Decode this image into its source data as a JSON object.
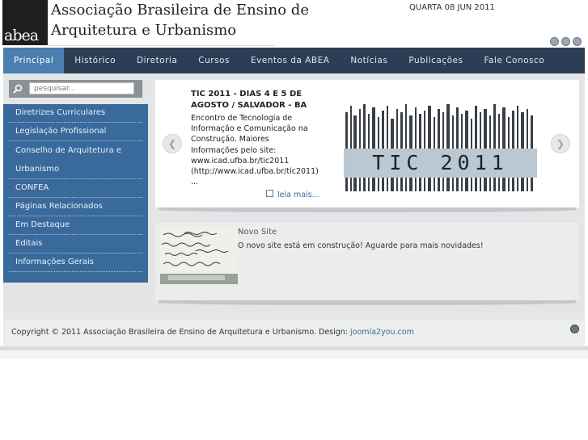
{
  "header": {
    "logo_mark": "abea",
    "logo_line1": "Associação Brasileira de Ensino de",
    "logo_line2": "Arquitetura e Urbanismo",
    "date": "QUARTA 08 JUN 2011",
    "font_tools": [
      "reset-font-icon",
      "decrease-font-icon",
      "increase-font-icon"
    ]
  },
  "nav": {
    "items": [
      "Principal",
      "Histórico",
      "Diretoria",
      "Cursos",
      "Eventos da ABEA",
      "Notícias",
      "Publicações",
      "Fale Conosco"
    ],
    "active_index": 0
  },
  "search": {
    "placeholder": "pesquisar..."
  },
  "sidebar": {
    "items": [
      "Diretrizes Curriculares",
      "Legislação Profissional",
      "Conselho de Arquitetura e Urbanismo",
      "CONFEA",
      "Páginas Relacionados",
      "Em Destaque",
      "Editais",
      "Informações Gerais"
    ]
  },
  "feature": {
    "title": "TIC 2011 - DIAS 4 E 5 DE AGOSTO / SALVADOR - BA",
    "body": "Encontro de Tecnologia de Informação e Comunicação na Construção. Maiores Informações pelo site: www.icad.ufba.br/tic2011 (http://www.icad.ufba.br/tic2011) ...",
    "read_more": "leia mais...",
    "banner_text": "TIC 2011"
  },
  "news": {
    "title": "Novo Site",
    "body": "O novo site está em construção! Aguarde para mais novidades!"
  },
  "footer": {
    "copyright": "Copyright © 2011 Associação Brasileira de Ensino de Arquitetura e Urbanismo. Design:",
    "design_link": "joomla2you.com"
  },
  "colors": {
    "nav_bg": "#2c3e55",
    "nav_active": "#4a7fb0",
    "sidebar_bg": "#3a6a9c",
    "content_bg": "#e3e5e7"
  }
}
